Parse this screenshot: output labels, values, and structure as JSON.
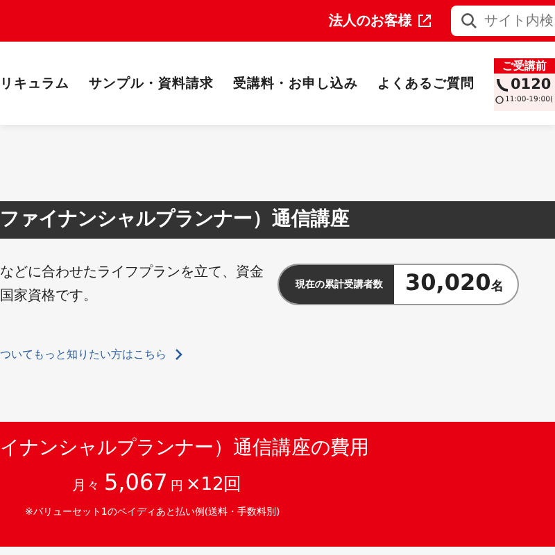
{
  "topbar": {
    "corporate_link": "法人のお客様",
    "search": {
      "placeholder": "サイト内検"
    }
  },
  "nav": {
    "items": [
      "リキュラム",
      "サンプル・資料請求",
      "受講料・お申し込み",
      "よくあるご質問"
    ],
    "phone": {
      "label": "ご受講前",
      "number": "0120",
      "hours": "11:00-19:00("
    }
  },
  "course": {
    "title": "ファイナンシャルプランナー）通信講座",
    "description": [
      "などに合わせたライフプランを立て、資金",
      "国家資格です。"
    ],
    "counter": {
      "label": "現在の累計受講者数",
      "value": "30,020",
      "unit": "名"
    },
    "link": "ついてもっと知りたい方はこちら"
  },
  "fee": {
    "title": "イナンシャルプランナー）通信講座の費用",
    "prefix": "月々",
    "amount": "5,067",
    "currency": "円",
    "times": "×12回",
    "note": "※バリューセット1のペイディあと払い例(送料・手数料別)"
  }
}
